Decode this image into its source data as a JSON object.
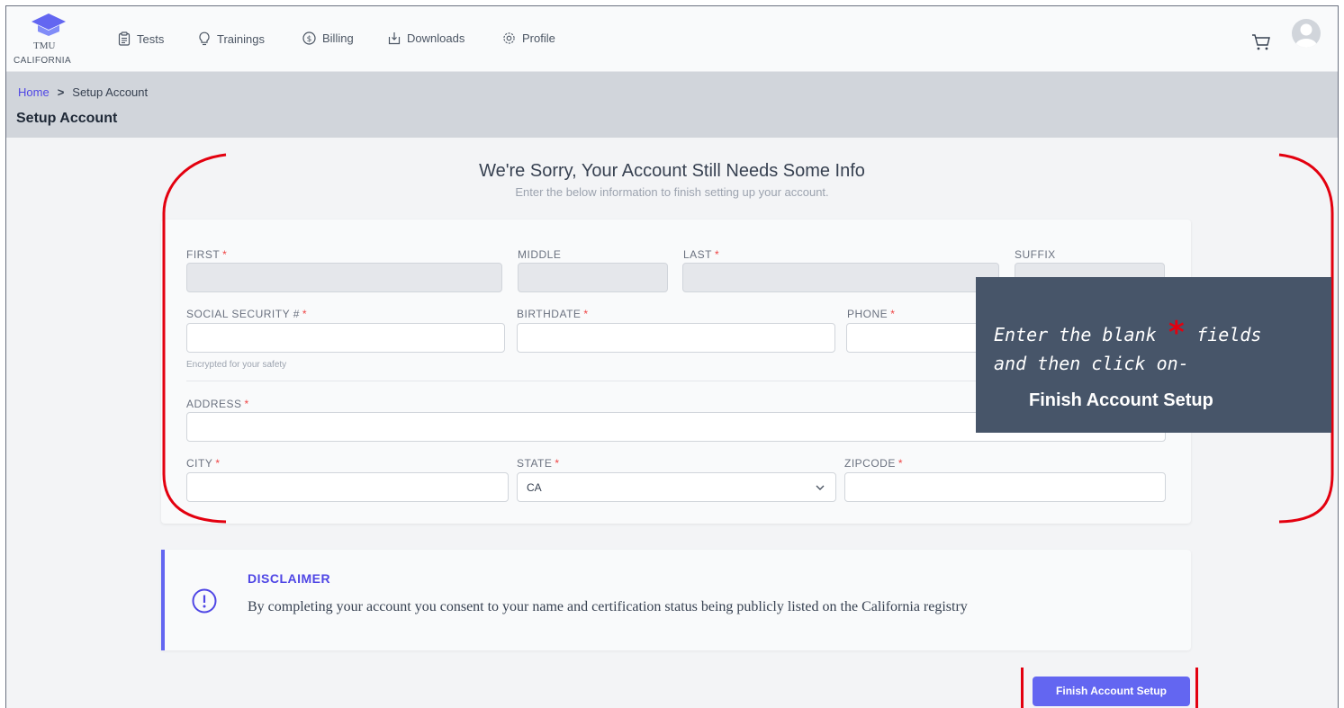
{
  "brand": {
    "logo_text": "TMU",
    "subtitle": "CALIFORNIA"
  },
  "nav": {
    "items": [
      {
        "label": "Tests",
        "icon": "clipboard-icon"
      },
      {
        "label": "Trainings",
        "icon": "lightbulb-icon"
      },
      {
        "label": "Billing",
        "icon": "dollar-circle-icon"
      },
      {
        "label": "Downloads",
        "icon": "download-box-icon"
      },
      {
        "label": "Profile",
        "icon": "gear-icon"
      }
    ],
    "cart_icon": "cart-icon",
    "avatar_icon": "user-avatar-icon"
  },
  "breadcrumb": {
    "home": "Home",
    "separator": ">",
    "current": "Setup Account"
  },
  "page_title": "Setup Account",
  "main": {
    "heading": "We're Sorry, Your Account Still Needs Some Info",
    "subheading": "Enter the below information to finish setting up your account."
  },
  "form": {
    "required_mark": "*",
    "first": {
      "label": "FIRST",
      "value": ""
    },
    "middle": {
      "label": "MIDDLE",
      "value": ""
    },
    "last": {
      "label": "LAST",
      "value": ""
    },
    "suffix": {
      "label": "SUFFIX",
      "value": ""
    },
    "ssn": {
      "label": "SOCIAL SECURITY #",
      "value": "",
      "help": "Encrypted for your safety"
    },
    "birthdate": {
      "label": "BIRTHDATE",
      "value": ""
    },
    "phone": {
      "label": "PHONE",
      "value": ""
    },
    "address": {
      "label": "ADDRESS",
      "value": ""
    },
    "city": {
      "label": "CITY",
      "value": ""
    },
    "state": {
      "label": "STATE",
      "value": "CA"
    },
    "zipcode": {
      "label": "ZIPCODE",
      "value": ""
    }
  },
  "disclaimer": {
    "title": "DISCLAIMER",
    "text": "By completing your account you consent to your name and certification status being publicly listed on the California registry"
  },
  "actions": {
    "finish_label": "Finish Account Setup"
  },
  "annotation": {
    "line1_before": "Enter the blank",
    "star": "*",
    "line1_after": "fields",
    "line2": "and then click on-",
    "line3": "Finish Account Setup",
    "bracket_color": "#e3000f",
    "box_color": "#475569"
  },
  "colors": {
    "accent": "#6366f1",
    "link": "#4f46e5",
    "required": "#ef4444"
  }
}
